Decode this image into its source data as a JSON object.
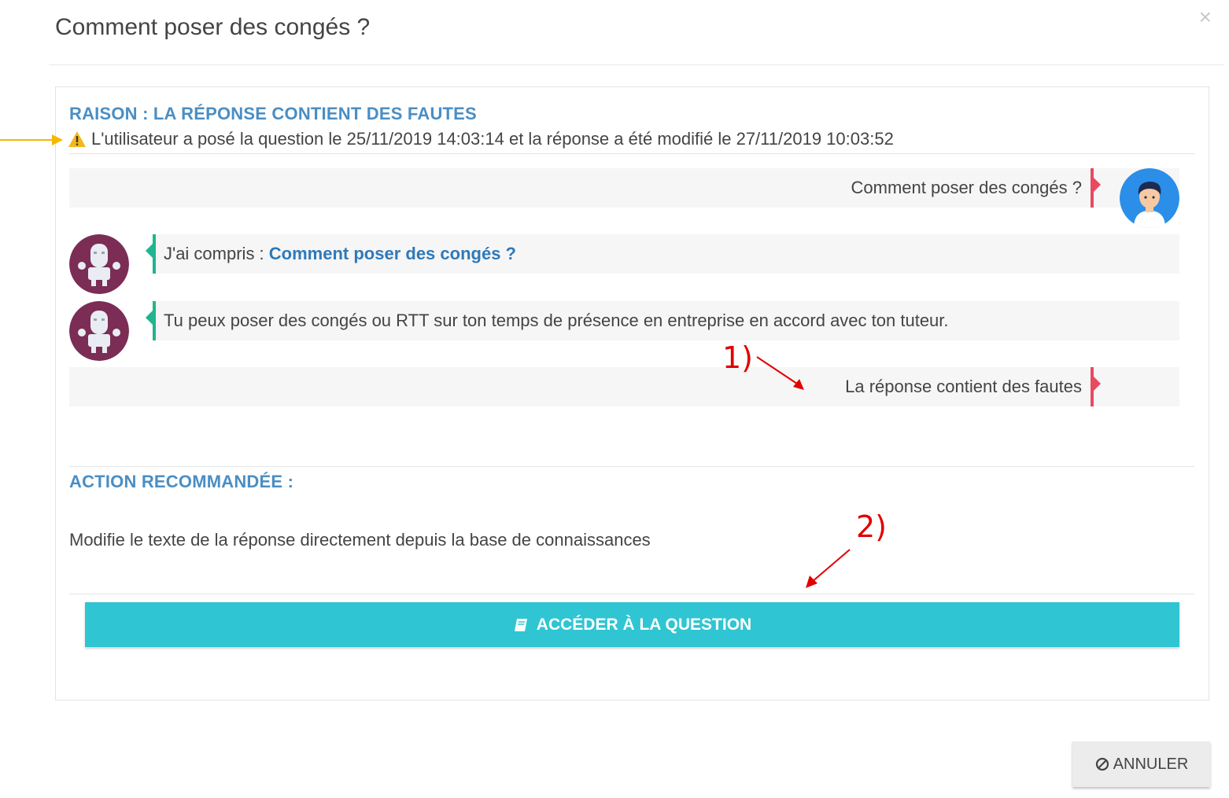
{
  "modal": {
    "title": "Comment poser des congés ?",
    "close_symbol": "×"
  },
  "reason": {
    "heading": "RAISON : LA RÉPONSE CONTIENT DES FAUTES",
    "warning_icon": "warning-triangle-icon",
    "warning_text": "L'utilisateur a posé la question le 25/11/2019 14:03:14 et la réponse a été modifié le 27/11/2019 10:03:52"
  },
  "conversation": {
    "user_question": "Comment poser des congés ?",
    "bot_understood_prefix": "J'ai compris : ",
    "bot_understood_link": "Comment poser des congés ?",
    "bot_answer": "Tu peux poser des congés ou RTT sur ton temps de présence en entreprise en accord avec ton tuteur.",
    "user_feedback": "La réponse contient des fautes"
  },
  "annotations": {
    "label_1": "1)",
    "label_2": "2)"
  },
  "action": {
    "heading": "ACTION RECOMMANDÉE :",
    "text": "Modifie le texte de la réponse directement depuis la base de connaissances",
    "button_label": "ACCÉDER À LA QUESTION",
    "button_icon": "book-icon"
  },
  "footer": {
    "cancel_label": "ANNULER",
    "cancel_icon": "ban-icon"
  },
  "colors": {
    "heading_blue": "#4a8ec4",
    "link_blue": "#2f79b9",
    "primary_button": "#30c5d2",
    "user_flag": "#e84a5f",
    "bot_flag": "#1fb58f",
    "bot_avatar": "#7b2d55",
    "user_avatar": "#2b8ee8",
    "annotation_red": "#e10000",
    "annotation_orange": "#f5b800"
  }
}
